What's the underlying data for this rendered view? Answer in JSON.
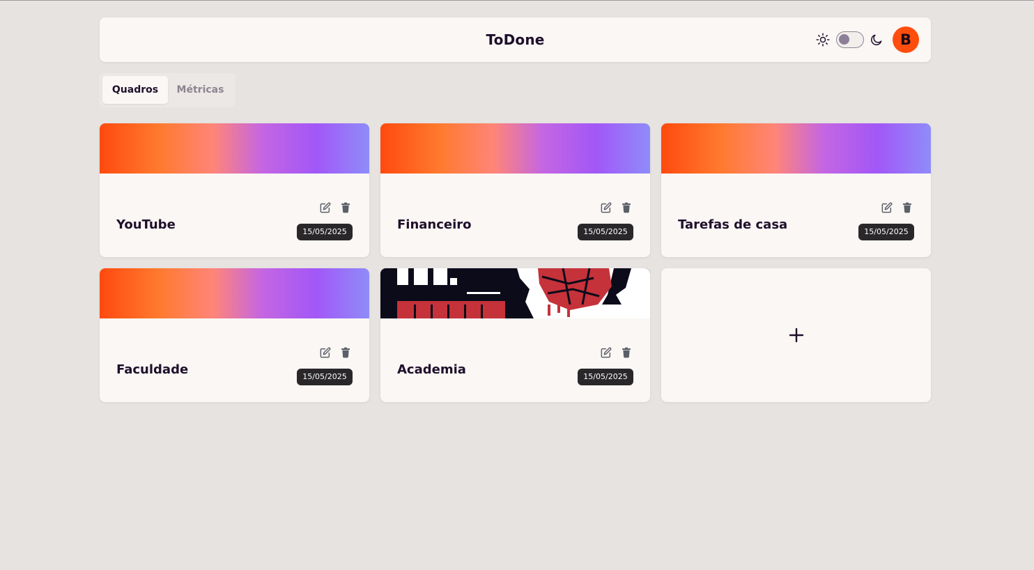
{
  "app": {
    "title": "ToDone"
  },
  "header": {
    "theme_toggle": {
      "light_icon": "sun-icon",
      "dark_icon": "moon-icon",
      "state": "light"
    },
    "avatar_initial": "B",
    "avatar_color": "#ff4d0d"
  },
  "tabs": [
    {
      "label": "Quadros",
      "active": true
    },
    {
      "label": "Métricas",
      "active": false
    }
  ],
  "boards": [
    {
      "title": "YouTube",
      "date": "15/05/2025",
      "banner": "gradient"
    },
    {
      "title": "Financeiro",
      "date": "15/05/2025",
      "banner": "gradient"
    },
    {
      "title": "Tarefas de casa",
      "date": "15/05/2025",
      "banner": "gradient"
    },
    {
      "title": "Faculdade",
      "date": "15/05/2025",
      "banner": "gradient"
    },
    {
      "title": "Academia",
      "date": "15/05/2025",
      "banner": "image"
    }
  ],
  "add_board": {
    "icon": "plus-icon"
  },
  "colors": {
    "accent": "#ff4d0d",
    "gradient": [
      "#ff4a0f",
      "#ff7a2e",
      "#ff8578",
      "#c566e2",
      "#a257f7",
      "#8f8cf9"
    ],
    "date_badge": "#29272a",
    "background": "#e7e3e0",
    "card": "#faf7f4"
  }
}
